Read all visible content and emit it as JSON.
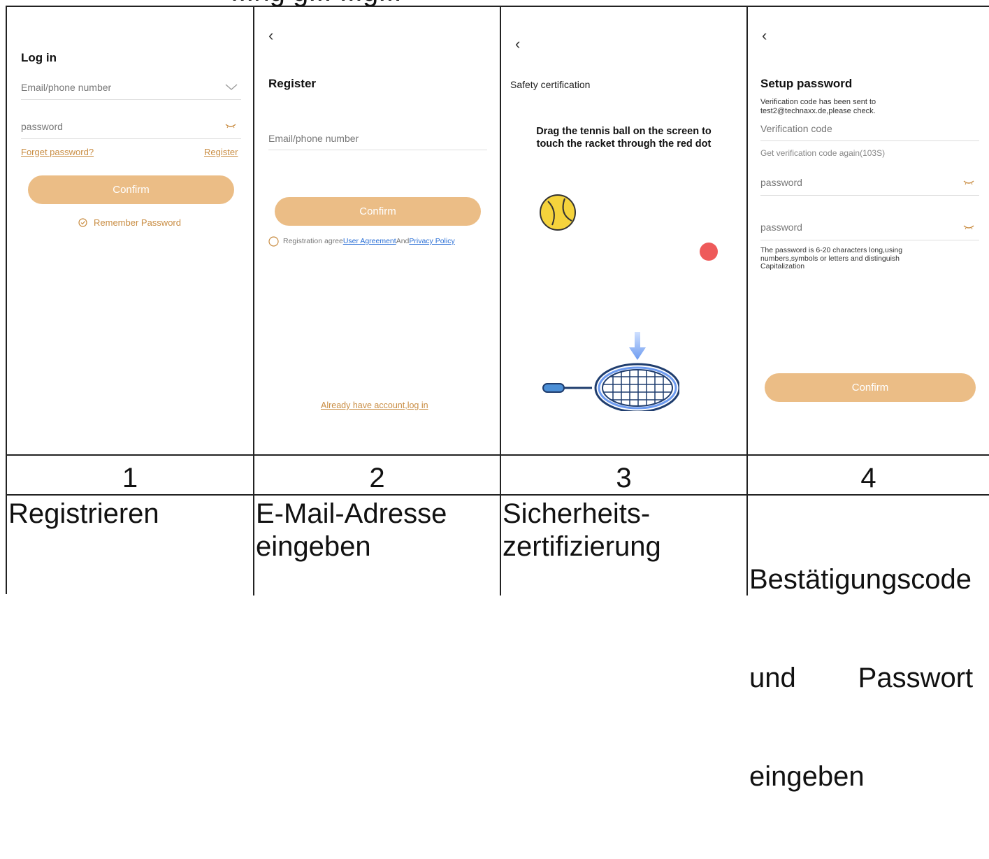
{
  "top_cut_text": "...ng g... ...g...",
  "panel1": {
    "title": "Log in",
    "email_placeholder": "Email/phone number",
    "password_placeholder": "password",
    "forget_password": "Forget password?",
    "register": "Register",
    "confirm": "Confirm",
    "remember_password": "Remember Password"
  },
  "panel2": {
    "title": "Register",
    "email_placeholder": "Email/phone number",
    "confirm": "Confirm",
    "agree_prefix": "Registration agree",
    "user_agreement": "User Agreement",
    "and": "And",
    "privacy_policy": "Privacy Policy",
    "already_have_account": "Already have account,log in"
  },
  "panel3": {
    "title": "Safety certification",
    "instruction_line1": "Drag the tennis ball on the screen to",
    "instruction_line2": "touch the racket through the red dot"
  },
  "panel4": {
    "title": "Setup password",
    "sent_line1": "Verification code has been sent to",
    "sent_line2": "test2@technaxx.de,please check.",
    "verification_code_placeholder": "Verification code",
    "get_code_again": "Get verification code again(103S)",
    "password_placeholder": "password",
    "password2_placeholder": "password",
    "hint_line1": "The password is 6-20 characters long,using",
    "hint_line2": "numbers,symbols or letters and distinguish",
    "hint_line3": "Capitalization",
    "confirm": "Confirm"
  },
  "steps": [
    {
      "number": "1",
      "caption_line1": "Registrieren",
      "caption_line2": "",
      "caption_line3": ""
    },
    {
      "number": "2",
      "caption_line1": "E-Mail-Adresse",
      "caption_line2": "eingeben",
      "caption_line3": ""
    },
    {
      "number": "3",
      "caption_line1": "Sicherheits-",
      "caption_line2": "zertifizierung",
      "caption_line3": ""
    },
    {
      "number": "4",
      "caption_line1": "Bestätigungscode",
      "caption_line2": "und        Passwort",
      "caption_line3": "eingeben"
    }
  ],
  "colors": {
    "accent": "#ebbd86",
    "link_orange": "#c98d43",
    "link_blue": "#2a6fd6",
    "ball_yellow": "#f5d33c",
    "red_dot": "#ee5a5a",
    "racket_blue": "#2c5a9e"
  }
}
